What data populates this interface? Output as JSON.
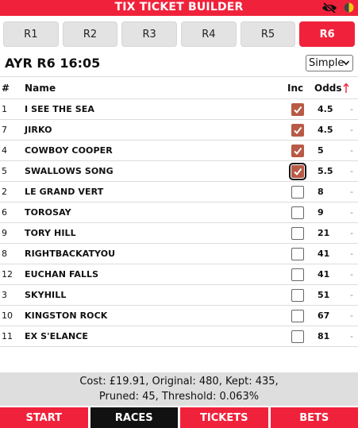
{
  "app": {
    "title": "TIX TICKET BUILDER"
  },
  "race_tabs": [
    {
      "label": "R1",
      "active": false
    },
    {
      "label": "R2",
      "active": false
    },
    {
      "label": "R3",
      "active": false
    },
    {
      "label": "R4",
      "active": false
    },
    {
      "label": "R5",
      "active": false
    },
    {
      "label": "R6",
      "active": true
    }
  ],
  "race": {
    "title": "AYR R6 16:05",
    "mode_selected": "Simple"
  },
  "table": {
    "headers": {
      "num": "#",
      "name": "Name",
      "inc": "Inc",
      "odds": "Odds"
    },
    "rows": [
      {
        "num": "1",
        "name": "I SEE THE SEA",
        "inc": true,
        "odds": "4.5",
        "dash": "-"
      },
      {
        "num": "7",
        "name": "JIRKO",
        "inc": true,
        "odds": "4.5",
        "dash": "-"
      },
      {
        "num": "4",
        "name": "COWBOY COOPER",
        "inc": true,
        "odds": "5",
        "dash": "-"
      },
      {
        "num": "5",
        "name": "SWALLOWS SONG",
        "inc": true,
        "odds": "5.5",
        "dash": "-",
        "focused": true
      },
      {
        "num": "2",
        "name": "LE GRAND VERT",
        "inc": false,
        "odds": "8",
        "dash": "-"
      },
      {
        "num": "6",
        "name": "TOROSAY",
        "inc": false,
        "odds": "9",
        "dash": "-"
      },
      {
        "num": "9",
        "name": "TORY HILL",
        "inc": false,
        "odds": "21",
        "dash": "-"
      },
      {
        "num": "8",
        "name": "RIGHTBACKATYOU",
        "inc": false,
        "odds": "41",
        "dash": "-"
      },
      {
        "num": "12",
        "name": "EUCHAN FALLS",
        "inc": false,
        "odds": "41",
        "dash": "-"
      },
      {
        "num": "3",
        "name": "SKYHILL",
        "inc": false,
        "odds": "51",
        "dash": "-"
      },
      {
        "num": "10",
        "name": "KINGSTON ROCK",
        "inc": false,
        "odds": "67",
        "dash": "-"
      },
      {
        "num": "11",
        "name": "EX S'ELANCE",
        "inc": false,
        "odds": "81",
        "dash": "-"
      }
    ]
  },
  "summary": {
    "line1": "Cost: £19.91, Original: 480, Kept: 435,",
    "line2": "Pruned: 45, Threshold: 0.063%"
  },
  "nav": [
    {
      "label": "START",
      "active": false
    },
    {
      "label": "RACES",
      "active": true
    },
    {
      "label": "TICKETS",
      "active": false
    },
    {
      "label": "BETS",
      "active": false
    }
  ],
  "colors": {
    "brand": "#f0223b",
    "checked": "#b85a45",
    "nav_active": "#111111"
  },
  "icons": {
    "visibility": "eye-off-icon",
    "theme": "contrast-icon",
    "sort": "sort-up-arrow-icon"
  }
}
